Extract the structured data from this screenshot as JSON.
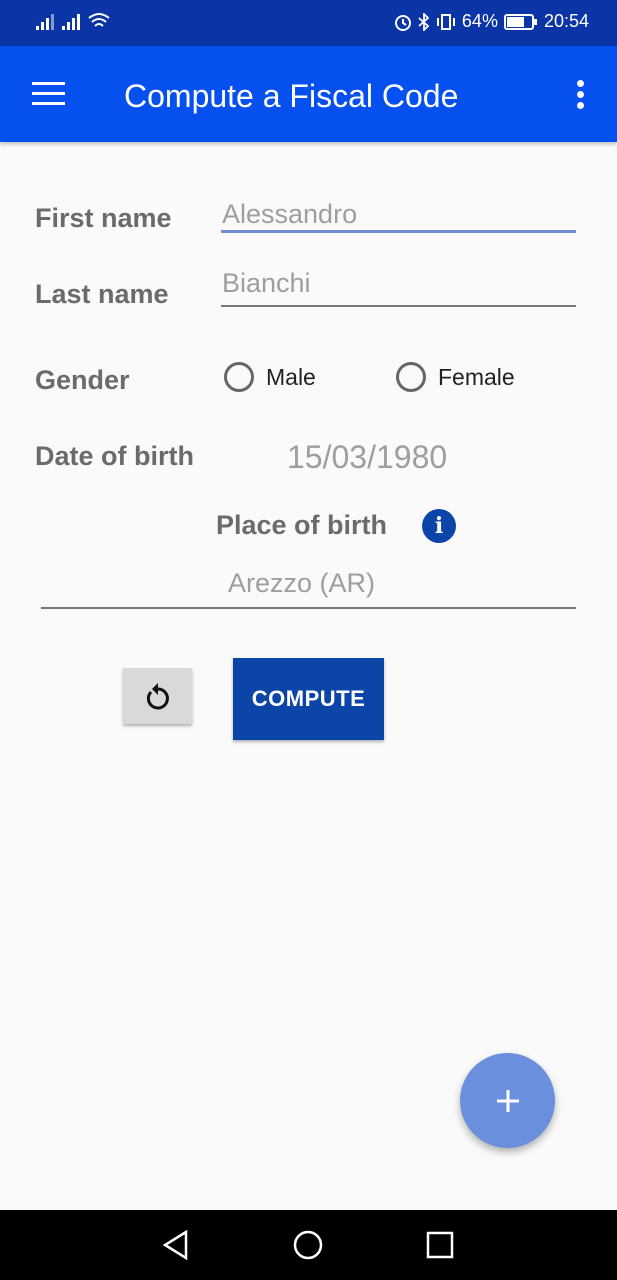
{
  "status_bar": {
    "battery": "64%",
    "time": "20:54"
  },
  "app_bar": {
    "title": "Compute a Fiscal Code"
  },
  "form": {
    "first_name": {
      "label": "First name",
      "value": "Alessandro"
    },
    "last_name": {
      "label": "Last name",
      "value": "Bianchi"
    },
    "gender": {
      "label": "Gender",
      "options": [
        "Male",
        "Female"
      ]
    },
    "date_of_birth": {
      "label": "Date of birth",
      "value": "15/03/1980"
    },
    "place_of_birth": {
      "label": "Place of birth",
      "value": "Arezzo (AR)"
    }
  },
  "actions": {
    "compute_label": "COMPUTE"
  },
  "colors": {
    "status_bar": "#0b34a6",
    "app_bar": "#0650f0",
    "primary_dark": "#0b45a8",
    "fab": "#6a8fdc"
  },
  "icons": [
    "menu-icon",
    "overflow-icon",
    "info-icon",
    "reset-icon",
    "add-icon",
    "back-icon",
    "home-icon",
    "recents-icon"
  ]
}
